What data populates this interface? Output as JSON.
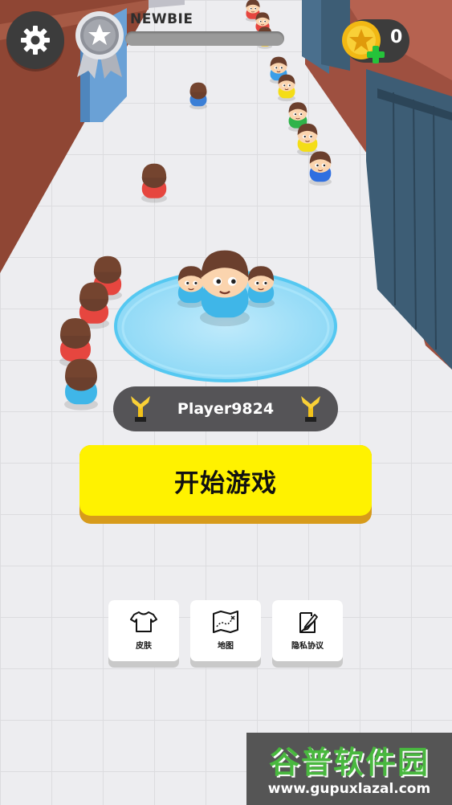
{
  "hud": {
    "rank_title": "NEWBIE",
    "xp_progress": 0,
    "coins": "0"
  },
  "player": {
    "name": "Player9824"
  },
  "start_button": {
    "label": "开始游戏"
  },
  "menu": [
    {
      "label": "皮肤",
      "icon": "shirt-icon"
    },
    {
      "label": "地图",
      "icon": "map-icon"
    },
    {
      "label": "隐私协议",
      "icon": "document-pen-icon"
    }
  ],
  "watermark": {
    "main": "谷普软件园",
    "url": "www.gupuxlazal.com"
  },
  "colors": {
    "accent_yellow": "#fff200",
    "button_shadow": "#d79b1b",
    "ring_blue": "#7fd3f4",
    "hud_dark": "#3c3c3c",
    "coin_gold": "#f4c21a",
    "plus_green": "#25c33a"
  }
}
